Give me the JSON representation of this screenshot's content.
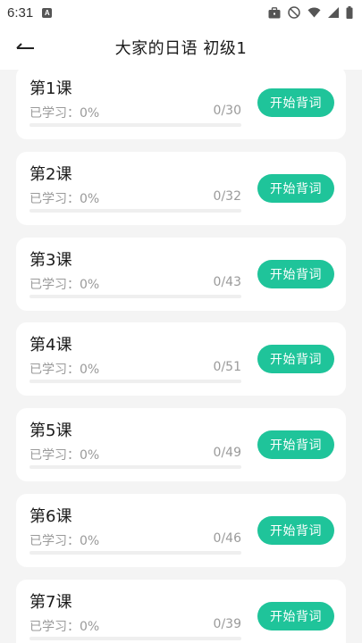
{
  "status_bar": {
    "time": "6:31",
    "notification_letter": "A"
  },
  "header": {
    "title": "大家的日语 初级1"
  },
  "lessons": [
    {
      "title": "第1课",
      "progress_label": "已学习：0%",
      "count": "0/30",
      "progress": 0,
      "button": "开始背词"
    },
    {
      "title": "第2课",
      "progress_label": "已学习：0%",
      "count": "0/32",
      "progress": 0,
      "button": "开始背词"
    },
    {
      "title": "第3课",
      "progress_label": "已学习：0%",
      "count": "0/43",
      "progress": 0,
      "button": "开始背词"
    },
    {
      "title": "第4课",
      "progress_label": "已学习：0%",
      "count": "0/51",
      "progress": 0,
      "button": "开始背词"
    },
    {
      "title": "第5课",
      "progress_label": "已学习：0%",
      "count": "0/49",
      "progress": 0,
      "button": "开始背词"
    },
    {
      "title": "第6课",
      "progress_label": "已学习：0%",
      "count": "0/46",
      "progress": 0,
      "button": "开始背词"
    },
    {
      "title": "第7课",
      "progress_label": "已学习：0%",
      "count": "0/39",
      "progress": 0,
      "button": "开始背词"
    }
  ],
  "colors": {
    "accent": "#1fc49a",
    "background": "#f4f4f4",
    "card": "#ffffff",
    "muted_text": "#9a9a9a"
  }
}
